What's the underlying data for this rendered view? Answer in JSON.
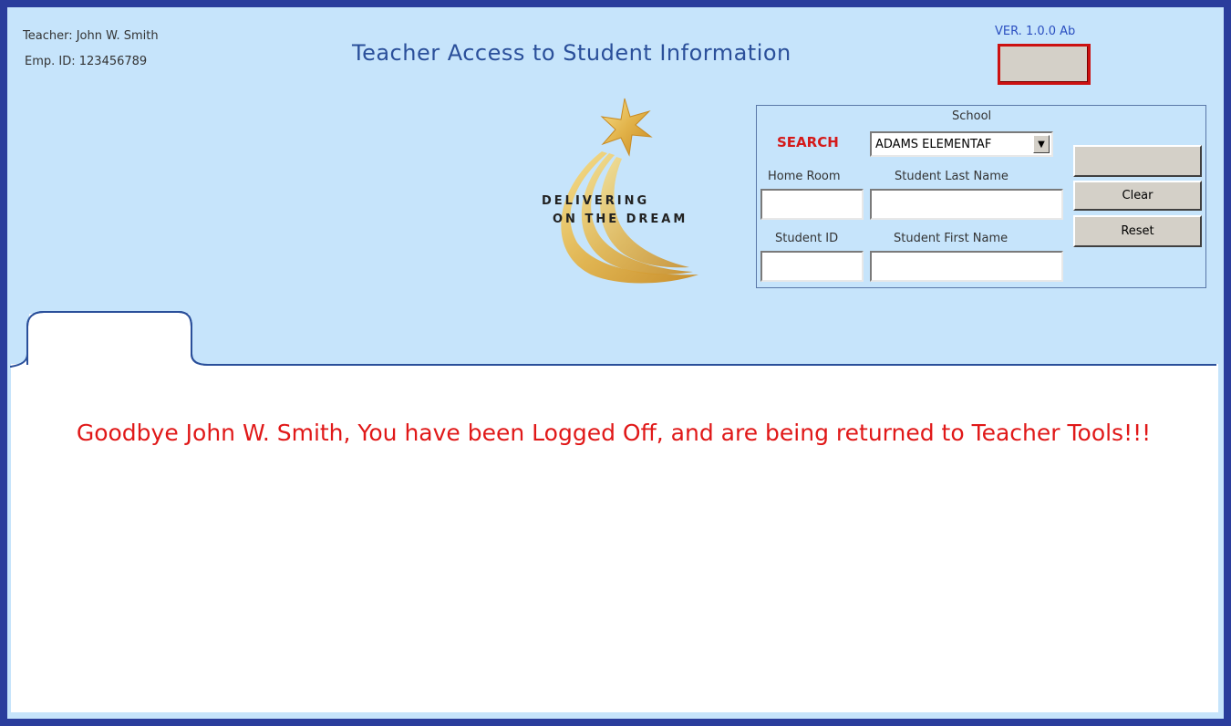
{
  "header": {
    "teacher": "Teacher: John W. Smith",
    "emp_id": "Emp. ID: 123456789",
    "title": "Teacher Access to Student Information",
    "version": "VER. 1.0.0 Ab"
  },
  "logo": {
    "line1": "DELIVERING",
    "line2": "ON THE DREAM",
    "icon": "shooting-star-icon"
  },
  "search": {
    "label": "SEARCH",
    "school_label": "School",
    "school_value": "ADAMS ELEMENTAF",
    "home_room_label": "Home Room",
    "last_name_label": "Student Last Name",
    "student_id_label": "Student ID",
    "first_name_label": "Student First Name",
    "home_room_value": "",
    "last_name_value": "",
    "student_id_value": "",
    "first_name_value": ""
  },
  "buttons": {
    "blank": "",
    "clear": "Clear",
    "reset": "Reset"
  },
  "tabs": [
    {
      "label": ""
    }
  ],
  "message": "Goodbye John W. Smith, You have been Logged Off, and are being returned to Teacher Tools!!!",
  "colors": {
    "frame": "#2a3d9c",
    "background": "#c6e4fb",
    "accent_red": "#e01818",
    "title_blue": "#2a4f9a"
  }
}
